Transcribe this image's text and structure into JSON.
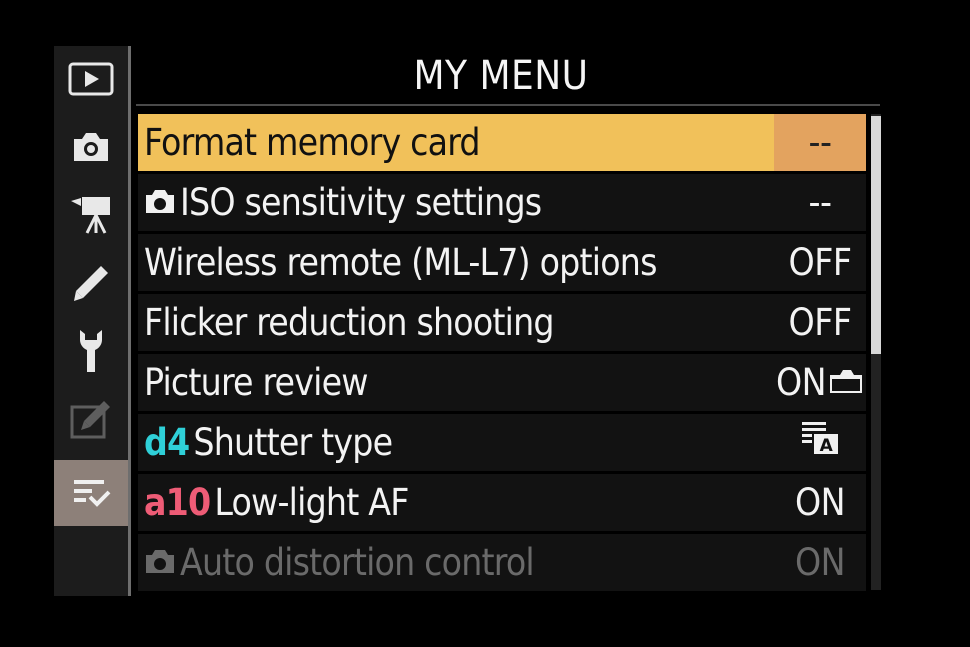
{
  "screen": {
    "title": "MY MENU"
  },
  "tabs": [
    {
      "name": "playback",
      "icon": "playback-icon"
    },
    {
      "name": "photo-shooting",
      "icon": "camera-icon"
    },
    {
      "name": "movie-shooting",
      "icon": "movie-camera-icon"
    },
    {
      "name": "custom-settings",
      "icon": "pencil-icon"
    },
    {
      "name": "setup",
      "icon": "wrench-icon"
    },
    {
      "name": "retouch",
      "icon": "retouch-icon"
    },
    {
      "name": "my-menu",
      "icon": "my-menu-icon",
      "active": true
    }
  ],
  "menu": {
    "items": [
      {
        "label": "Format memory card",
        "value": "--",
        "selected": true
      },
      {
        "prefix_icon": "camera-small-icon",
        "label": "ISO sensitivity settings",
        "value": "--"
      },
      {
        "label": "Wireless remote (ML-L7) options",
        "value": "OFF"
      },
      {
        "label": "Flicker reduction shooting",
        "value": "OFF"
      },
      {
        "label": "Picture review",
        "value": "ON",
        "value_icon": "camera-small-icon"
      },
      {
        "prefix": "d4",
        "prefix_color": "#2fd0d8",
        "label": "Shutter type",
        "value_icon": "auto-shutter-icon"
      },
      {
        "prefix": "a10",
        "prefix_color": "#ee5c76",
        "label": "Low-light AF",
        "value": "ON"
      },
      {
        "prefix_icon": "camera-small-icon",
        "label": "Auto distortion control",
        "value": "ON",
        "disabled": true
      }
    ]
  },
  "colors": {
    "highlight": "#f1c15a",
    "highlight_value": "#e3a35f",
    "active_tab": "#8d8079"
  }
}
